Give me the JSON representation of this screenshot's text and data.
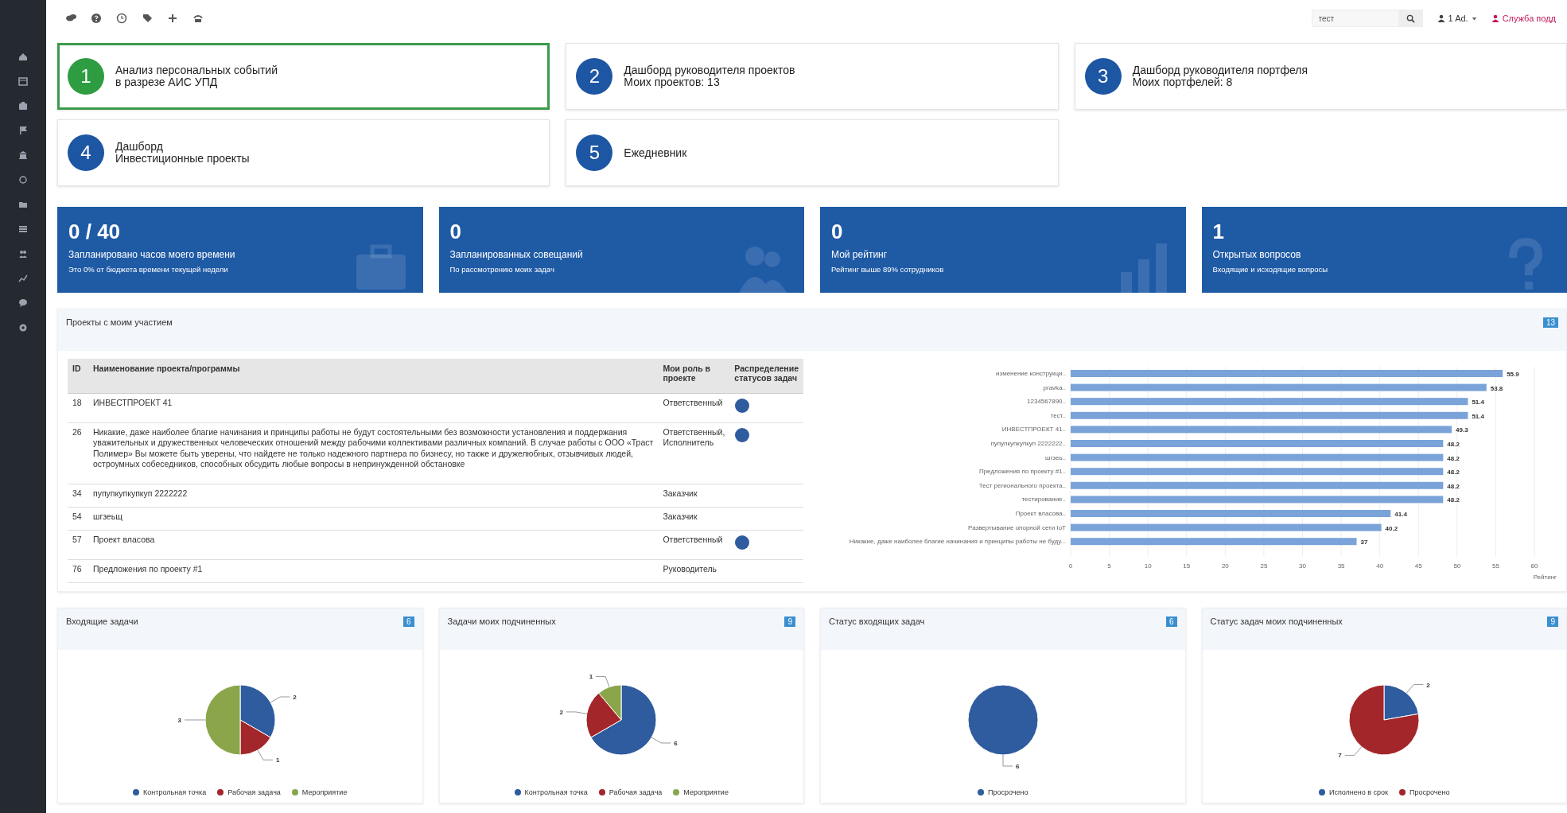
{
  "topbar": {
    "search": {
      "value": "тест"
    },
    "user": "1 Ad.",
    "support_link": "Служба подд"
  },
  "nav_cards": [
    {
      "number": "1",
      "lines": [
        "Анализ персональных событий",
        "в разрезе АИС УПД"
      ],
      "selected": true
    },
    {
      "number": "2",
      "lines": [
        "Дашборд руководителя проектов",
        "Моих проектов: 13"
      ],
      "selected": false
    },
    {
      "number": "3",
      "lines": [
        "Дашборд руководителя портфеля",
        "Моих портфелей: 8"
      ],
      "selected": false
    },
    {
      "number": "4",
      "lines": [
        "Дашборд",
        "Инвестиционные проекты"
      ],
      "selected": false
    },
    {
      "number": "5",
      "lines": [
        "Ежедневник"
      ],
      "selected": false
    }
  ],
  "stat_tiles": [
    {
      "value": "0 / 40",
      "title": "Запланировано часов моего времени",
      "subtitle": "Это 0% от бюджета времени текущей недели"
    },
    {
      "value": "0",
      "title": "Запланированных совещаний",
      "subtitle": "По рассмотрению моих задач"
    },
    {
      "value": "0",
      "title": "Мой рейтинг",
      "subtitle": "Рейтинг выше 89% сотрудников"
    },
    {
      "value": "1",
      "title": "Открытых вопросов",
      "subtitle": "Входящие и исходящие вопросы"
    }
  ],
  "projects_panel": {
    "title": "Проекты с моим участием",
    "count": "13",
    "table": {
      "columns": [
        "ID",
        "Наименование проекта/программы",
        "Мои роль в проекте",
        "Распределение статусов задач"
      ],
      "rows": [
        {
          "id": "18",
          "name": "ИНВЕСТПРОЕКТ 41",
          "role": "Ответственный",
          "has_status_chart": true
        },
        {
          "id": "26",
          "name": "Никакие, даже наиболее благие начинания и принципы работы не будут состоятельными без возможности установления и поддержания уважительных и дружественных человеческих отношений между рабочими коллективами различных компаний. В случае работы с ООО «Траст Полимер» Вы можете быть уверены, что найдете не только надежного партнера по бизнесу, но также и дружелюбных, отзывчивых людей, остроумных собеседников, способных обсудить любые вопросы в непринужденной обстановке",
          "role": "Ответственный, Исполнитель",
          "has_status_chart": true
        },
        {
          "id": "34",
          "name": "пупупкупкупкуп 2222222",
          "role": "Заказчик",
          "has_status_chart": false
        },
        {
          "id": "54",
          "name": "шгзеьщ",
          "role": "Заказчик",
          "has_status_chart": false
        },
        {
          "id": "57",
          "name": "Проект власова",
          "role": "Ответственный",
          "has_status_chart": true
        },
        {
          "id": "76",
          "name": "Предложения по проекту #1",
          "role": "Руководитель",
          "has_status_chart": false
        }
      ]
    },
    "chart_data": {
      "type": "bar",
      "orientation": "horizontal",
      "xlabel": "Рейтинг",
      "categories": [
        "изменение конструкци..",
        "pravka..",
        "1234567890..",
        "тест..",
        "ИНВЕСТПРОЕКТ 41..",
        "пупупкупкупкуп 2222222..",
        "шгзеь..",
        "Предложения по проекту #1..",
        "Тест регионального проекта..",
        "тестирование..",
        "Проект власова..",
        "Развертывание опорной сети IoT",
        "Никакие, даже наиболее благие начинания и принципы работы не буду..."
      ],
      "values": [
        55.9,
        53.8,
        51.4,
        51.4,
        49.3,
        48.2,
        48.2,
        48.2,
        48.2,
        48.2,
        41.4,
        40.2,
        37
      ],
      "xlim": [
        0,
        60
      ],
      "xticks": [
        0,
        5,
        10,
        15,
        20,
        25,
        30,
        35,
        40,
        45,
        50,
        55,
        60
      ],
      "data_labels": true,
      "grid": true
    }
  },
  "pie_panels": [
    {
      "title": "Входящие задачи",
      "count": "6",
      "chart_data": {
        "type": "pie",
        "categories": [
          "Контрольная точка",
          "Рабочая задача",
          "Мероприятие"
        ],
        "values": [
          2,
          1,
          3
        ],
        "data_labels": true
      }
    },
    {
      "title": "Задачи моих подчиненных",
      "count": "9",
      "chart_data": {
        "type": "pie",
        "categories": [
          "Контрольная точка",
          "Рабочая задача",
          "Мероприятие"
        ],
        "values": [
          6,
          2,
          1
        ],
        "data_labels": true
      }
    },
    {
      "title": "Статус входящих задач",
      "count": "6",
      "chart_data": {
        "type": "pie",
        "categories": [
          "Просрочено"
        ],
        "values": [
          6
        ],
        "data_labels": true
      }
    },
    {
      "title": "Статус задач моих подчиненных",
      "count": "9",
      "chart_data": {
        "type": "pie",
        "categories": [
          "Исполнено в срок",
          "Просрочено"
        ],
        "values": [
          2,
          7
        ],
        "data_labels": true
      }
    }
  ]
}
